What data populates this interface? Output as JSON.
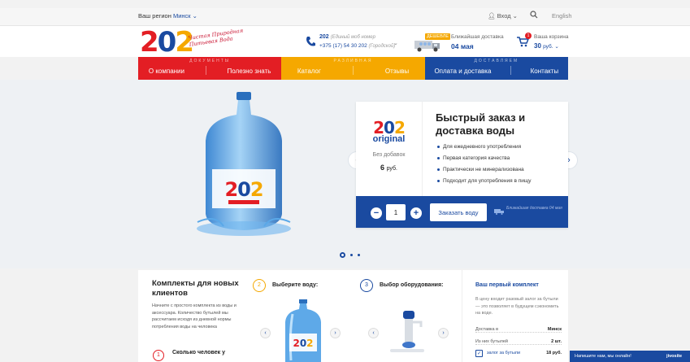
{
  "topbar": {
    "region_label": "Ваш регион",
    "region_value": "Минск ⌄",
    "login": "Вход ⌄",
    "lang": "English"
  },
  "header": {
    "logo": {
      "d1": "2",
      "d2": "0",
      "d3": "2"
    },
    "slogan": "Чистая Природная Питьевая Вода",
    "phone1_num": "202",
    "phone1_note": "(Единый моб номер",
    "phone2_num": "+375 (17) 54 30 202",
    "phone2_note": "(Городской)",
    "cheap_badge": "ДЕШЕВЛЕ",
    "delivery_label": "Ближайшая доставка",
    "delivery_date": "04 мая",
    "cart_count": "1",
    "cart_label": "Ваша корзина",
    "cart_sum": "30",
    "cart_unit": "руб. ⌄"
  },
  "nav": {
    "groups": [
      {
        "caption": "ДОКУМЕНТЫ",
        "items": [
          "О компании",
          "Полезно знать"
        ]
      },
      {
        "caption": "РАЗЛИВНАЯ",
        "items": [
          "Каталог",
          "Отзывы"
        ]
      },
      {
        "caption": "ДОСТАВЛЯЕМ",
        "items": [
          "Оплата и доставка",
          "Контакты"
        ]
      }
    ]
  },
  "hero": {
    "promo": {
      "logo": {
        "a": "2",
        "b": "0",
        "c": "2"
      },
      "original": "original",
      "no_additives": "Без добавок",
      "price": "6",
      "price_unit": "руб.",
      "title": "Быстрый заказ и доставка воды",
      "features": [
        "Для ежедневного употребления",
        "Первая категория качества",
        "Практически не минерализована",
        "Подходит для употребления в пищу"
      ],
      "qty": "1",
      "order_button": "Заказать воду",
      "bar_note": "Ближайшая доставка 04 мая"
    },
    "bottle_label": "202",
    "slides_count": 3,
    "active_slide": 1
  },
  "kits": {
    "title": "Комплекты для новых клиентов",
    "desc": "Начните с простого комплекта из воды и аксессуара. Количество бутылей мы рассчитаем исходя из дневной нормы потребления воды на человека",
    "howmany_num": "1",
    "howmany": "Сколько человек у",
    "step1_num": "2",
    "step1": "Выберите воду:",
    "step2_num": "3",
    "step2": "Выбор оборудования:",
    "bottle_label": "202"
  },
  "first_kit": {
    "title": "Ваш первый комплект",
    "desc": "В цену входит разовый залог за бутыли — это позволяет в будущем сэкономить на воде.",
    "rows": [
      {
        "label": "Доставка в",
        "value": "Минск"
      },
      {
        "label": "Из них бутылей",
        "value": "2 шт."
      }
    ],
    "deposit_label": "залог за бутыли",
    "deposit_value": "18 руб."
  },
  "chat": {
    "text": "Напишите нам, мы онлайн!",
    "brand": "jivosite"
  },
  "colors": {
    "red": "#e31e24",
    "orange": "#f5a800",
    "blue": "#1a4aa0"
  }
}
